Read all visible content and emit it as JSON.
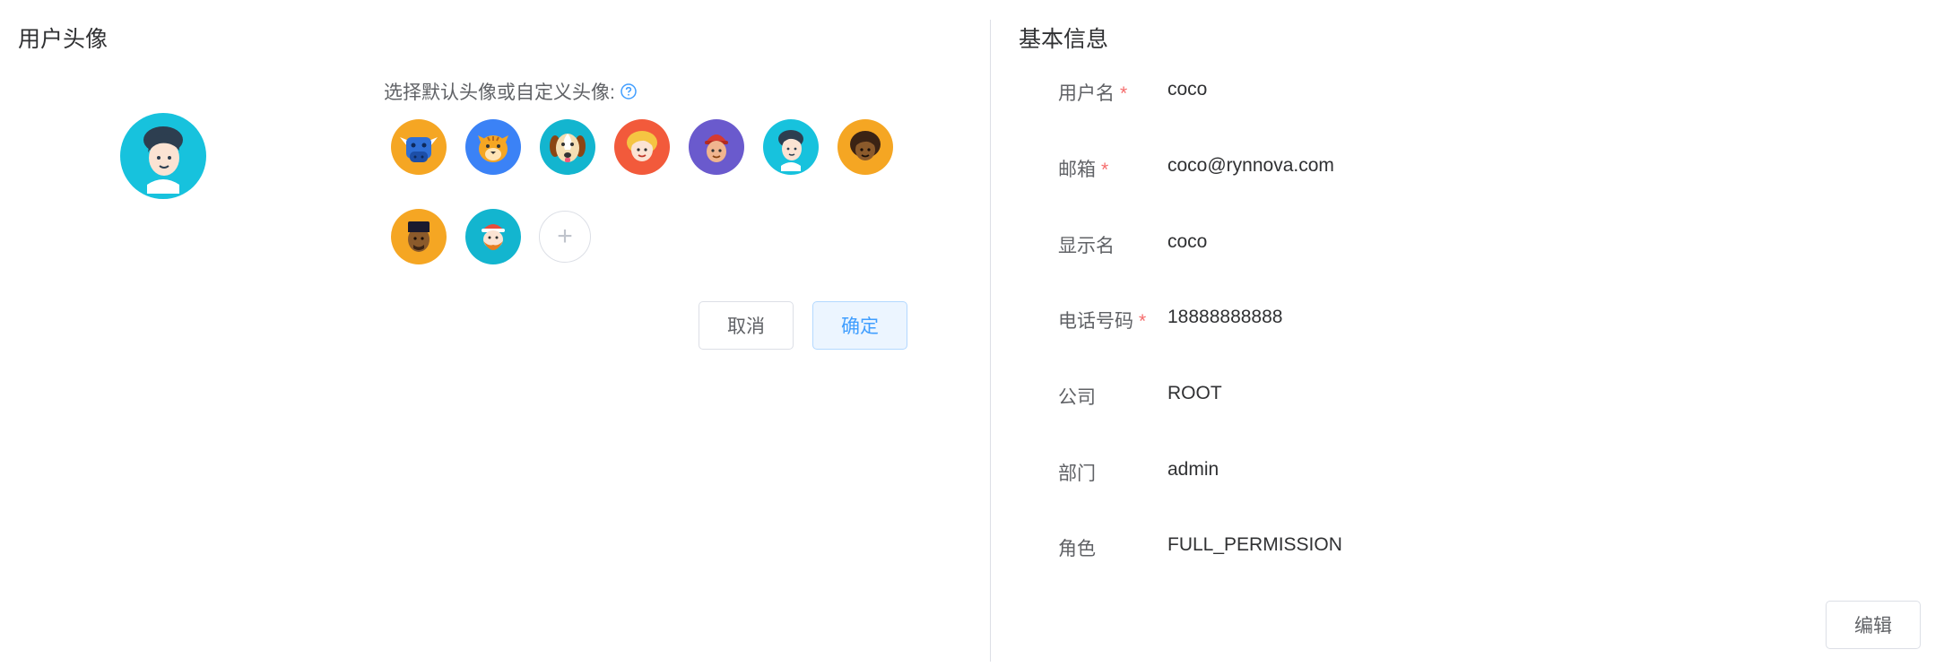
{
  "left_panel": {
    "title": "用户头像",
    "hint": "选择默认头像或自定义头像:",
    "add_symbol": "+",
    "cancel_label": "取消",
    "confirm_label": "确定",
    "avatar_options": [
      {
        "icon": "bull-avatar-icon",
        "bg": "#f5a623"
      },
      {
        "icon": "tiger-avatar-icon",
        "bg": "#3b82f6"
      },
      {
        "icon": "dog-avatar-icon",
        "bg": "#13b5cf"
      },
      {
        "icon": "blonde-girl-avatar-icon",
        "bg": "#f25a3b"
      },
      {
        "icon": "red-hat-avatar-icon",
        "bg": "#6a5acd"
      },
      {
        "icon": "girl-avatar-icon",
        "bg": "#17c2dd"
      },
      {
        "icon": "dark-skin-woman-avatar-icon",
        "bg": "#f5a623"
      },
      {
        "icon": "dark-skin-man-avatar-icon",
        "bg": "#f5a623"
      },
      {
        "icon": "bearded-man-avatar-icon",
        "bg": "#13b5cf"
      }
    ]
  },
  "right_panel": {
    "title": "基本信息",
    "edit_label": "编辑",
    "required_mark": "*",
    "fields": [
      {
        "label": "用户名",
        "value": "coco",
        "required": true
      },
      {
        "label": "邮箱",
        "value": "coco@rynnova.com",
        "required": true
      },
      {
        "label": "显示名",
        "value": "coco",
        "required": false
      },
      {
        "label": "电话号码",
        "value": "18888888888",
        "required": true
      },
      {
        "label": "公司",
        "value": "ROOT",
        "required": false
      },
      {
        "label": "部门",
        "value": "admin",
        "required": false
      },
      {
        "label": "角色",
        "value": "FULL_PERMISSION",
        "required": false
      }
    ]
  },
  "colors": {
    "primary": "#409eff",
    "required": "#f56c6c",
    "selected_avatar_bg": "#17c2dd"
  }
}
